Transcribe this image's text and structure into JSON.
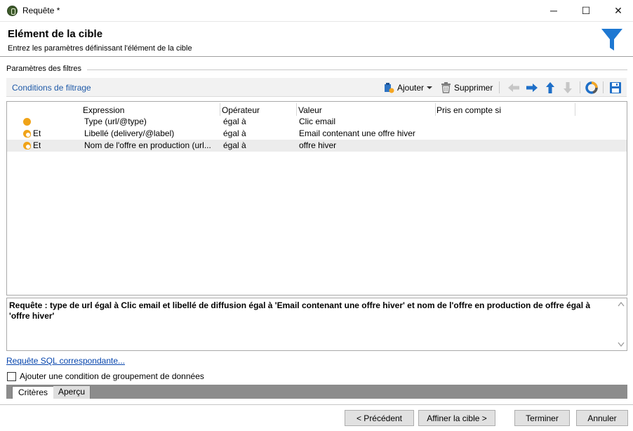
{
  "window": {
    "title": "Requête *",
    "controls": {
      "minimize": "─",
      "maximize": "☐",
      "close": "✕"
    }
  },
  "header": {
    "title": "Elément de la cible",
    "subtitle": "Entrez les paramètres définissant l'élément de la cible"
  },
  "filters": {
    "group_label": "Paramètres des filtres",
    "toolbar": {
      "title": "Conditions de filtrage",
      "add_label": "Ajouter",
      "delete_label": "Supprimer",
      "icons": [
        "add-condition-icon",
        "trash-icon",
        "arrow-left-icon",
        "arrow-right-icon",
        "arrow-up-icon",
        "arrow-down-icon",
        "distribution-chart-icon",
        "save-icon"
      ]
    },
    "columns": [
      "Expression",
      "Opérateur",
      "Valeur",
      "Pris en compte si"
    ],
    "rows": [
      {
        "logic": "",
        "expression": "Type (url/@type)",
        "operator": "égal à",
        "value": "Clic email",
        "condition": ""
      },
      {
        "logic": "Et",
        "expression": "Libellé (delivery/@label)",
        "operator": "égal à",
        "value": "Email contenant une offre hiver",
        "condition": ""
      },
      {
        "logic": "Et",
        "expression": "Nom de l'offre en production (url...",
        "operator": "égal à",
        "value": "offre hiver",
        "condition": ""
      }
    ]
  },
  "query": {
    "text": "Requête : type de url égal à Clic email et libellé de diffusion égal à 'Email contenant une offre hiver' et nom de l'offre en production de offre égal à 'offre hiver'"
  },
  "sql_link": "Requête SQL correspondante...",
  "grouping": {
    "label": "Ajouter une condition de groupement de données",
    "checked": false
  },
  "tabs": [
    "Critères",
    "Aperçu"
  ],
  "footer": {
    "prev": "< Précédent",
    "refine": "Affiner la cible >",
    "finish": "Terminer",
    "cancel": "Annuler"
  },
  "colors": {
    "accent_blue": "#1f5aa8",
    "funnel_blue": "#1e78d2",
    "bullet_orange": "#f0a318"
  }
}
